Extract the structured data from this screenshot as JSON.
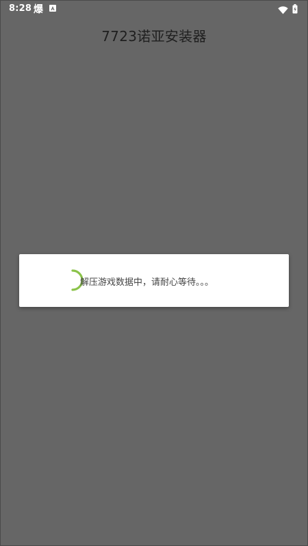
{
  "status_bar": {
    "time": "8:28",
    "notification_glyph": "爆",
    "icons": [
      "notification-icon",
      "app-a-icon",
      "wifi-icon",
      "battery-icon"
    ]
  },
  "app": {
    "title": "7723诺亚安装器"
  },
  "dialog": {
    "message": "解压游戏数据中，请耐心等待。。。",
    "spinner_color": "#8BC34A"
  },
  "colors": {
    "scrim": "#666666",
    "dialog_bg": "#FFFFFF",
    "title_text": "#1F1F1F"
  }
}
